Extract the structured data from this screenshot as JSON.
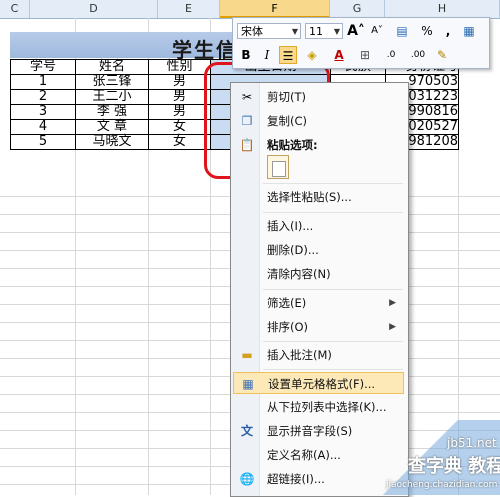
{
  "columns": [
    "C",
    "D",
    "E",
    "F",
    "G",
    "H"
  ],
  "sheet": {
    "title_visible": "学生信",
    "headers": [
      "学号",
      "姓名",
      "性别",
      "出生日期",
      "民族",
      "身份证号"
    ],
    "rows": [
      {
        "id": "1",
        "name": "张三锋",
        "gender": "男",
        "idno": "970503"
      },
      {
        "id": "2",
        "name": "王二小",
        "gender": "男",
        "idno": "031223"
      },
      {
        "id": "3",
        "name": "李 强",
        "gender": "男",
        "idno": "990816"
      },
      {
        "id": "4",
        "name": "文 章",
        "gender": "女",
        "idno": "020527"
      },
      {
        "id": "5",
        "name": "马晓文",
        "gender": "女",
        "idno": "981208"
      }
    ]
  },
  "mini_toolbar": {
    "font_name": "宋体",
    "font_size": "11",
    "grow_font": "A",
    "shrink_font": "A",
    "percent": "%",
    "comma": ",",
    "bold": "B",
    "italic": "I",
    "font_color": "A",
    "inc_decimal": ".0",
    "dec_decimal": ".00"
  },
  "menu": {
    "cut": "剪切(T)",
    "copy": "复制(C)",
    "paste_options": "粘贴选项:",
    "paste_special": "选择性粘贴(S)...",
    "insert": "插入(I)...",
    "delete": "删除(D)...",
    "clear": "清除内容(N)",
    "filter": "筛选(E)",
    "sort": "排序(O)",
    "insert_comment": "插入批注(M)",
    "format_cells": "设置单元格格式(F)...",
    "pick_list": "从下拉列表中选择(K)...",
    "phonetic": "显示拼音字段(S)",
    "define_name": "定义名称(A)...",
    "hyperlink": "超链接(I)..."
  },
  "watermark": {
    "site": "jb51.net",
    "brand": "查字典 教程网",
    "url": "jiaocheng.chazidian.com"
  },
  "colors": {
    "highlight": "#fde9b8",
    "selection_border": "#e0151b",
    "title_band": "#9fb9de"
  }
}
